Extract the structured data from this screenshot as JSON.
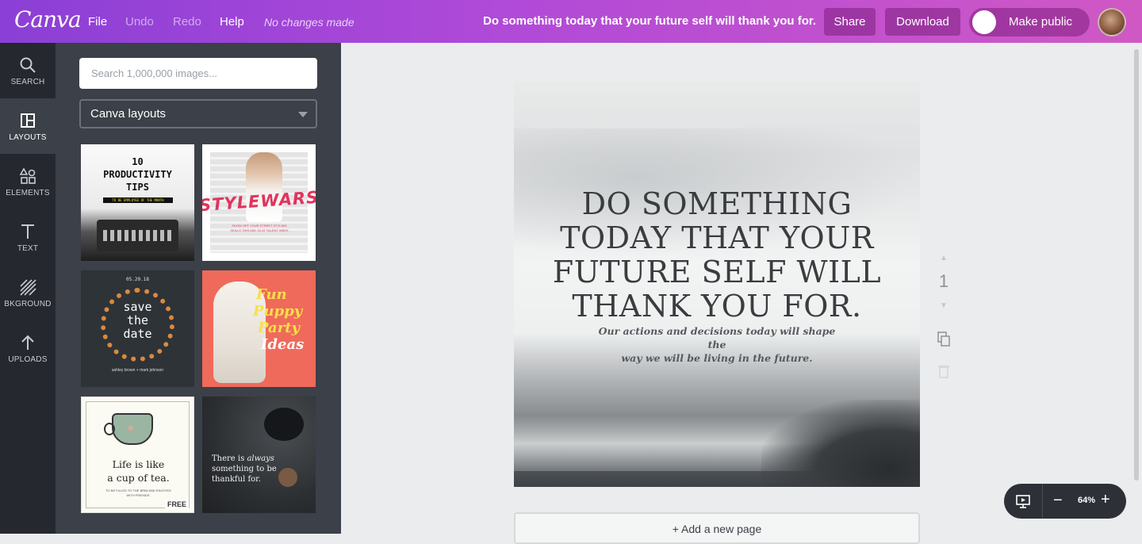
{
  "topbar": {
    "logo": "Canva",
    "menu": [
      "File",
      "Undo",
      "Redo",
      "Help"
    ],
    "status": "No changes made",
    "tagline": "Do something today that your future self will thank you for.",
    "share": "Share",
    "download": "Download",
    "make_public": "Make public",
    "colors": {
      "gradient_start": "#8b3fd6",
      "gradient_end": "#d058c4"
    }
  },
  "sidebar": {
    "items": [
      {
        "label": "SEARCH",
        "icon": "magnifier-icon"
      },
      {
        "label": "LAYOUTS",
        "icon": "layout-icon",
        "active": true
      },
      {
        "label": "ELEMENTS",
        "icon": "shapes-icon"
      },
      {
        "label": "TEXT",
        "icon": "text-icon"
      },
      {
        "label": "BKGROUND",
        "icon": "hatch-icon"
      },
      {
        "label": "UPLOADS",
        "icon": "upload-arrow-icon"
      }
    ]
  },
  "panel": {
    "search_placeholder": "Search 1,000,000 images...",
    "dropdown_value": "Canva layouts",
    "templates": [
      {
        "lines": [
          "10",
          "PRODUCTIVITY",
          "TIPS"
        ],
        "sub": "TO BE EMPLOYEE OF THE MONTH"
      },
      {
        "title": "STYLEWARS",
        "sub": "SHOW OFF YOUR STREET STYLING SKILLS THIS MAY 20 AT TALENT WEEK"
      },
      {
        "date": "05.20.18",
        "lines": [
          "save",
          "the",
          "date"
        ],
        "names": "ashley brown + mark johnson"
      },
      {
        "lines": [
          "Fun",
          "Puppy",
          "Party",
          "Ideas"
        ]
      },
      {
        "lines": [
          "Life is like",
          "a cup of tea."
        ],
        "sub": "TO BE FILLED TO THE BRIM AND ENJOYED WITH FRIENDS.",
        "badge": "FREE"
      },
      {
        "line1": "There is",
        "emph": "always",
        "line2": "something to be",
        "line3": "thankful for."
      }
    ]
  },
  "design": {
    "headline": [
      "DO SOMETHING",
      "TODAY THAT YOUR",
      "FUTURE SELF WILL",
      "THANK YOU FOR."
    ],
    "subtext": [
      "Our actions and decisions today will shape the",
      "way we will be living in the future."
    ]
  },
  "page_controls": {
    "page_number": "1"
  },
  "add_page": "+ Add a new page",
  "zoom": {
    "minus": "−",
    "value": "64%",
    "plus": "+"
  }
}
